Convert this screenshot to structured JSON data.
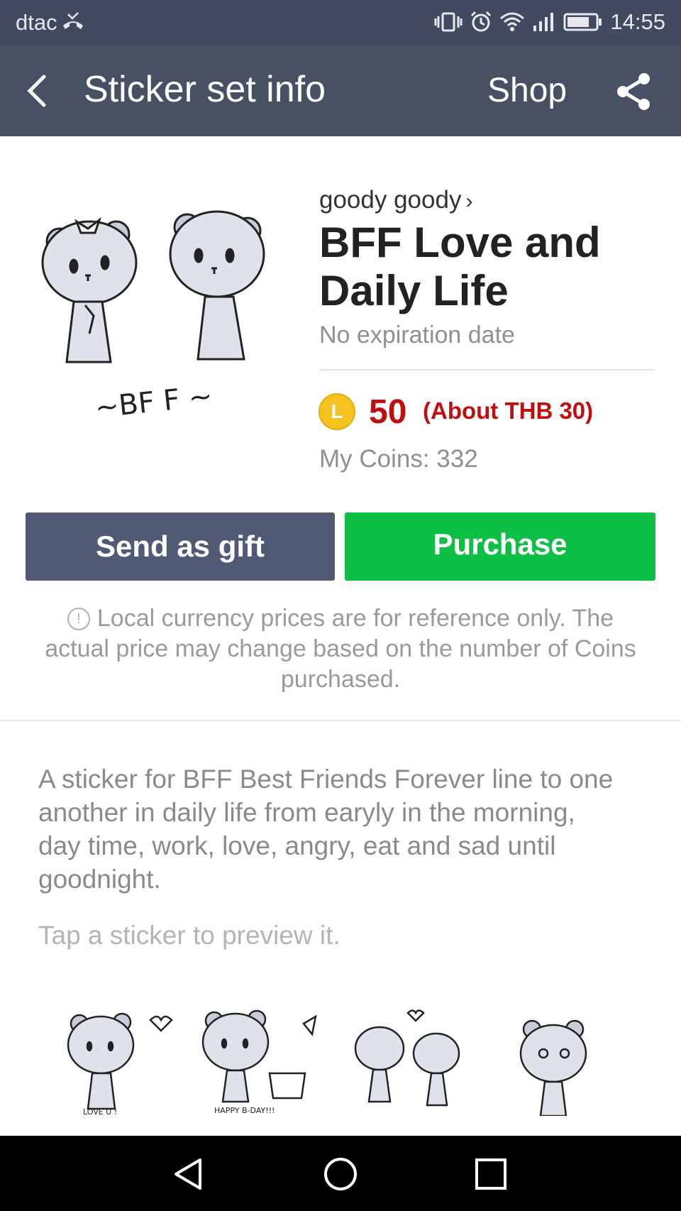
{
  "status_bar": {
    "carrier": "dtac",
    "time": "14:55",
    "icons": [
      "missed-call-icon",
      "vibrate-icon",
      "alarm-icon",
      "wifi-icon",
      "signal-icon",
      "battery-icon"
    ]
  },
  "header": {
    "back_icon": "back-arrow-icon",
    "title": "Sticker set info",
    "shop_label": "Shop",
    "share_icon": "share-icon"
  },
  "sticker_set": {
    "author": "goody goody",
    "title": "BFF Love and Daily Life",
    "expiry": "No expiration date",
    "coin_symbol": "L",
    "price": "50",
    "price_local": "(About THB 30)",
    "my_coins": "My Coins: 332",
    "art_caption": "~BF F ~"
  },
  "buttons": {
    "gift": "Send as gift",
    "purchase": "Purchase"
  },
  "notice": "Local currency prices are for reference only. The actual price may change based on the number of Coins purchased.",
  "description": "A sticker for BFF Best Friends Forever line to one another in daily life from earyly in the morning, day time, work, love, angry, eat and sad until goodnight.",
  "hint": "Tap a sticker to preview it.",
  "stickers": [
    {
      "caption": "LOVE U !"
    },
    {
      "caption": "HAPPY B-DAY!!!"
    },
    {
      "caption": ""
    },
    {
      "caption": ""
    }
  ],
  "nav": [
    "back-triangle-icon",
    "home-circle-icon",
    "recents-square-icon"
  ],
  "colors": {
    "header": "#485064",
    "status_bar": "#414a5e",
    "gift_button": "#515a74",
    "purchase_button": "#0ebf46",
    "price": "#c00f0f",
    "coin": "#f5c320"
  }
}
